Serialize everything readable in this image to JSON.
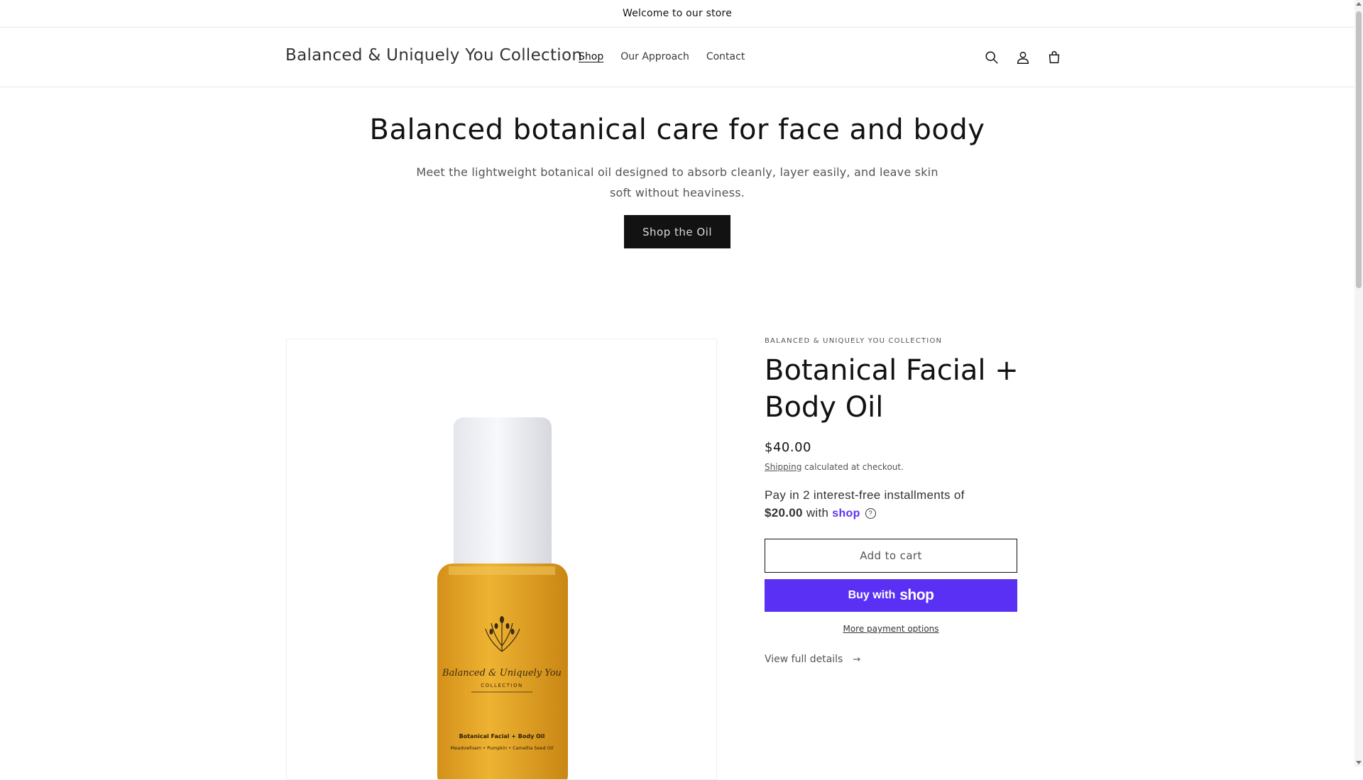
{
  "announcement": {
    "text": "Welcome to our store"
  },
  "header": {
    "logo": "Balanced & Uniquely You Collection",
    "nav": [
      {
        "label": "Shop",
        "active": true
      },
      {
        "label": "Our Approach",
        "active": false
      },
      {
        "label": "Contact",
        "active": false
      }
    ],
    "icons": [
      "search-icon",
      "account-icon",
      "cart-icon"
    ]
  },
  "hero": {
    "title": "Balanced botanical care for face and body",
    "description": "Meet the lightweight botanical oil designed to absorb cleanly, layer easily, and leave skin soft without heaviness.",
    "cta": "Shop the Oil"
  },
  "product": {
    "vendor": "BALANCED & UNIQUELY YOU COLLECTION",
    "title": "Botanical Facial + Body Oil",
    "price": "$40.00",
    "shipping_link": "Shipping",
    "shipping_text": " calculated at checkout.",
    "installments_text": "Pay in 2 interest-free installments of",
    "installments_amount": "$20.00",
    "installments_with": " with ",
    "installments_brand": "shop",
    "add_to_cart": "Add to cart",
    "buy_with": "Buy with",
    "buy_brand": "shop",
    "more_payment": "More payment options",
    "view_details": "View full details",
    "image": {
      "label_brand": "Balanced & Uniquely You",
      "label_sub": "COLLECTION",
      "label_product": "Botanical Facial + Body Oil",
      "label_ingredients": "Meadowfoam • Pumpkin • Camellia Seed Oil"
    }
  },
  "colors": {
    "accent_shop": "#5a31f4",
    "dark_button": "#121212",
    "oil_amber": "#e0a320"
  }
}
